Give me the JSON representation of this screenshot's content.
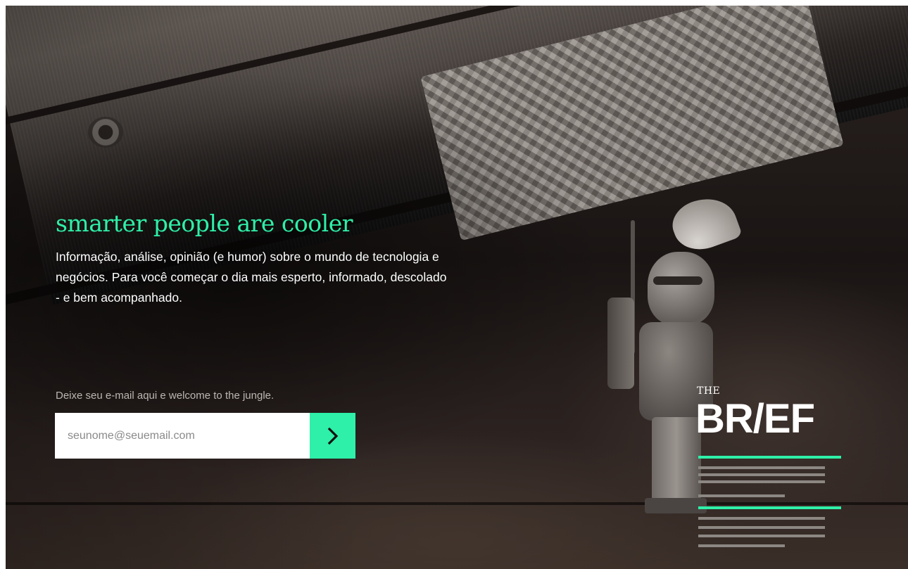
{
  "hero": {
    "headline": "smarter people are cooler",
    "lead": "Informação, análise, opinião (e humor) sobre o mundo de tecnologia e negócios. Para você começar o dia mais esperto, informado, descolado - e bem acompanhado.",
    "prompt": "Deixe seu e-mail aqui e welcome to the jungle."
  },
  "signup": {
    "email_placeholder": "seunome@seuemail.com",
    "submit_icon": "chevron-right-icon"
  },
  "logo": {
    "the": "THE",
    "word": "BR/EF"
  },
  "colors": {
    "accent": "#2ef0a8",
    "text": "#ffffff",
    "muted": "#bdb7b2",
    "logo_lines": "#8c8782"
  }
}
